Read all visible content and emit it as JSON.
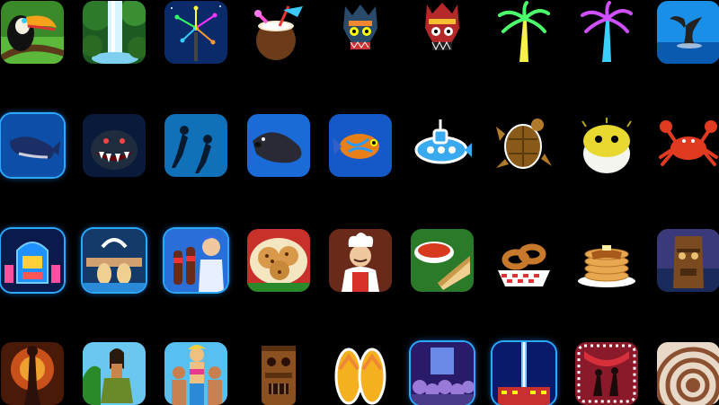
{
  "grid": {
    "rows": [
      [
        "toucan-icon",
        "waterfall-icon",
        "fireworks-tree-icon",
        "coconut-drink-icon",
        "tiki-mask-icon",
        "tiki-mask-red-icon",
        "neon-palm-green-icon",
        "neon-palm-purple-icon",
        "whale-tail-icon"
      ],
      [
        "whale-icon",
        "angler-fish-icon",
        "scuba-divers-icon",
        "seal-icon",
        "mandarin-fish-icon",
        "submarine-icon",
        "sea-turtle-icon",
        "pufferfish-icon",
        "crab-icon"
      ],
      [
        "jukebox-icon",
        "diner-booth-icon",
        "soda-girl-icon",
        "cookies-icon",
        "chef-icon",
        "soup-sandwich-icon",
        "onion-rings-icon",
        "pancakes-icon",
        "tiki-statue-icon"
      ],
      [
        "fire-dancer-icon",
        "hula-dancer-icon",
        "beach-crowd-icon",
        "tiki-totem-icon",
        "flip-flops-icon",
        "concert-crowd-icon",
        "city-tower-icon",
        "dance-stage-icon",
        "dome-building-icon"
      ]
    ]
  }
}
